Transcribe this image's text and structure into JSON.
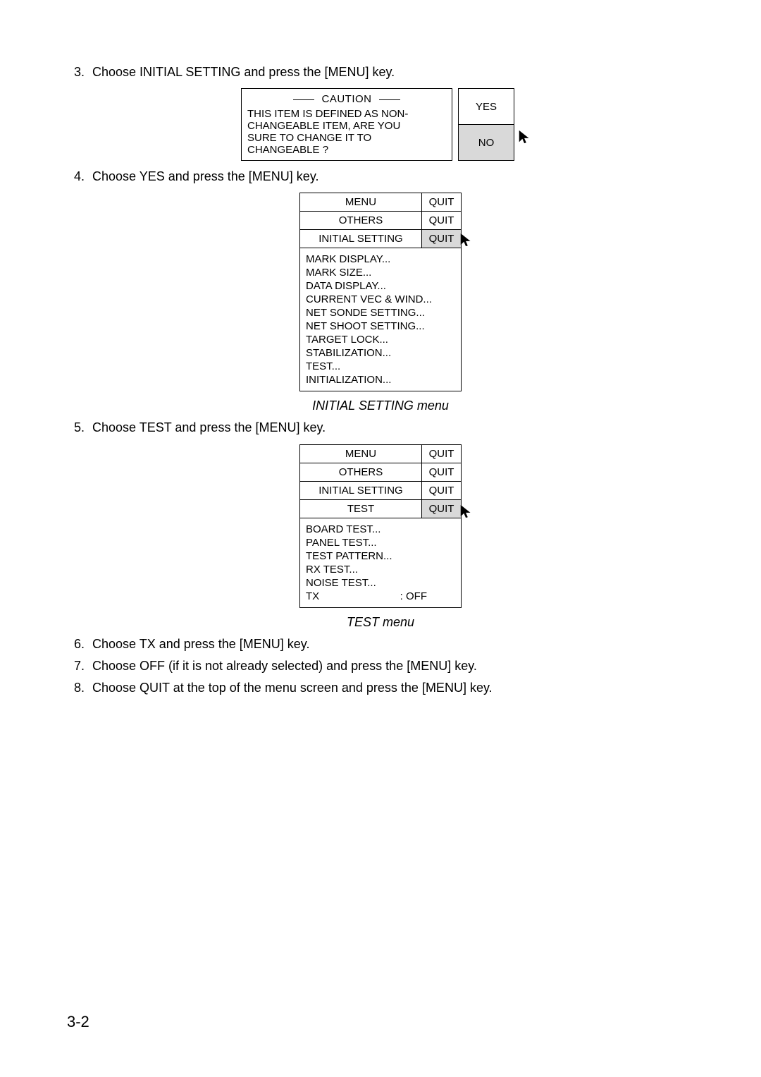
{
  "page_number": "3-2",
  "steps": {
    "s3": "Choose INITIAL SETTING and press the [MENU] key.",
    "s4": "Choose YES and press the [MENU] key.",
    "s5": "Choose TEST and press the [MENU] key.",
    "s6": "Choose TX and press the [MENU] key.",
    "s7": "Choose OFF (if it is not already selected) and press the [MENU] key.",
    "s8": "Choose QUIT at the top of the menu screen and press the [MENU] key."
  },
  "caution": {
    "title": "CAUTION",
    "body_l1": "THIS ITEM IS DEFINED AS NON-",
    "body_l2": "CHANGEABLE ITEM, ARE YOU",
    "body_l3": "SURE TO CHANGE IT TO CHANGEABLE ?",
    "yes": "YES",
    "no": "NO"
  },
  "menu1": {
    "r1_name": "MENU",
    "r1_quit": "QUIT",
    "r2_name": "OTHERS",
    "r2_quit": "QUIT",
    "r3_name": "INITIAL SETTING",
    "r3_quit": "QUIT",
    "items": {
      "i0": "MARK DISPLAY...",
      "i1": "MARK SIZE...",
      "i2": "DATA DISPLAY...",
      "i3": "CURRENT VEC & WIND...",
      "i4": "NET SONDE SETTING...",
      "i5": "NET SHOOT SETTING...",
      "i6": "TARGET LOCK...",
      "i7": "STABILIZATION...",
      "i8": "TEST...",
      "i9": "INITIALIZATION..."
    },
    "caption": "INITIAL SETTING menu"
  },
  "menu2": {
    "r1_name": "MENU",
    "r1_quit": "QUIT",
    "r2_name": "OTHERS",
    "r2_quit": "QUIT",
    "r3_name": "INITIAL SETTING",
    "r3_quit": "QUIT",
    "r4_name": "TEST",
    "r4_quit": "QUIT",
    "items": {
      "i0": "BOARD TEST...",
      "i1": "PANEL TEST...",
      "i2": "TEST PATTERN...",
      "i3": "RX TEST...",
      "i4": "NOISE TEST..."
    },
    "tx_label": "TX",
    "tx_value": ": OFF",
    "caption": "TEST menu"
  }
}
